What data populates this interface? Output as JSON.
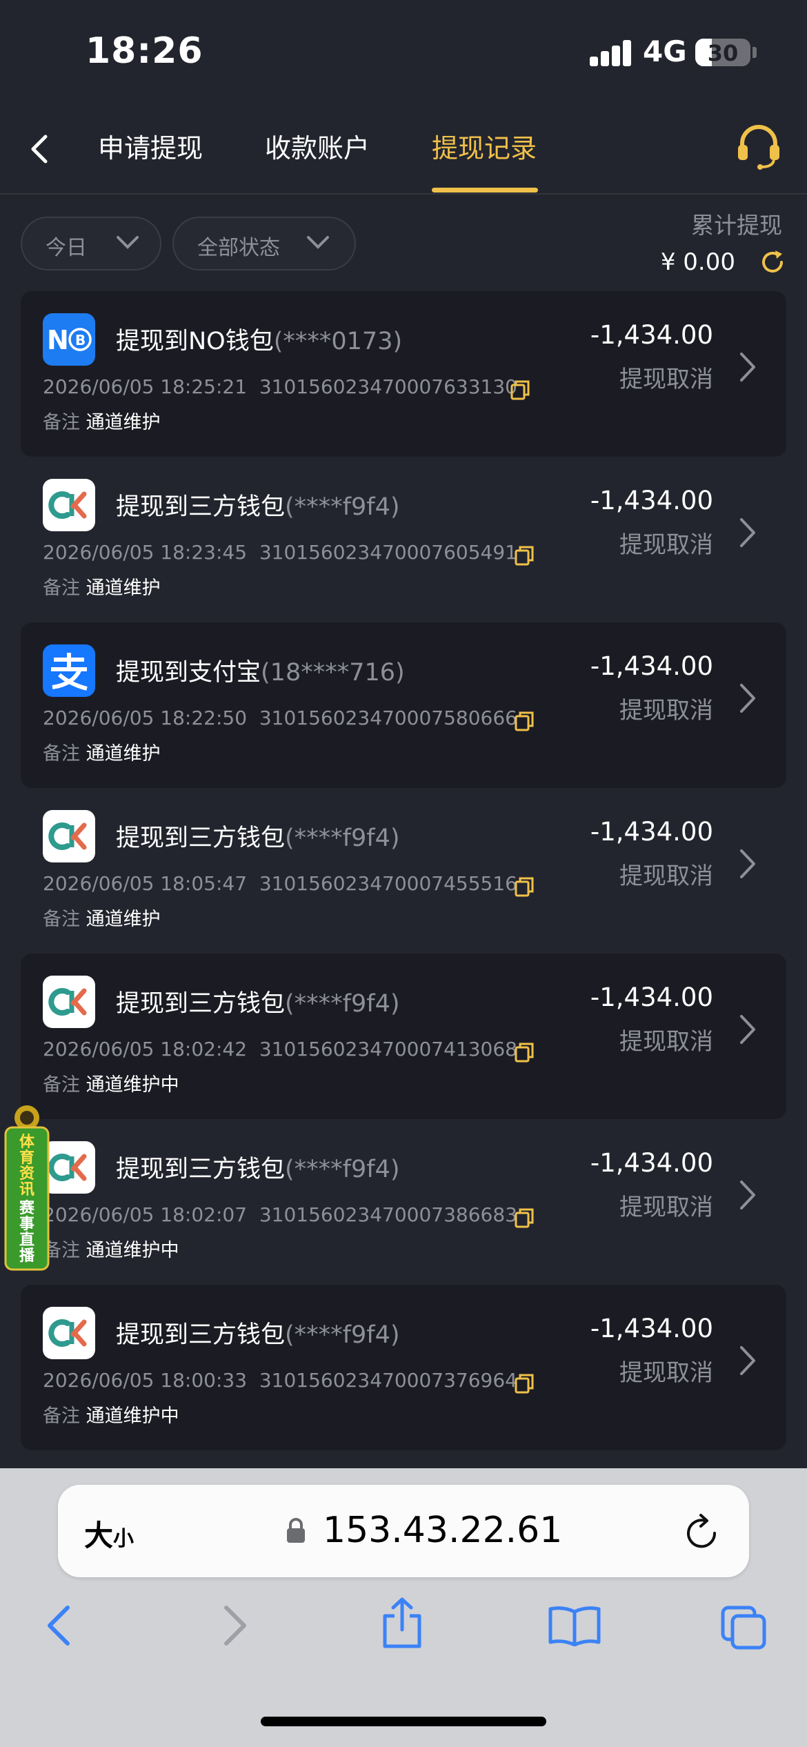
{
  "status_bar": {
    "time": "18:26",
    "network": "4G",
    "battery": "30",
    "battery_level": 0.3
  },
  "nav": {
    "tabs": [
      {
        "label": "申请提现",
        "active": false
      },
      {
        "label": "收款账户",
        "active": false
      },
      {
        "label": "提现记录",
        "active": true
      }
    ]
  },
  "filters": {
    "date": "今日",
    "status": "全部状态"
  },
  "summary": {
    "label": "累计提现",
    "amount": "¥ 0.00"
  },
  "records": [
    {
      "logo": "nb-icon",
      "title": "提现到NO钱包",
      "account": "(****0173)",
      "datetime": "2026/06/05 18:25:21",
      "order_no": "3101560234700076331​30",
      "note_label": "备注",
      "note": "通道维护",
      "amount": "-1,434.00",
      "status": "提现取消"
    },
    {
      "logo": "ck-icon",
      "title": "提现到三方钱包",
      "account": "(****f9f4)",
      "datetime": "2026/06/05 18:23:45",
      "order_no": "310156023470007605491",
      "note_label": "备注",
      "note": "通道维护",
      "amount": "-1,434.00",
      "status": "提现取消"
    },
    {
      "logo": "alipay-icon",
      "title": "提现到支付宝",
      "account": "(18****716)",
      "datetime": "2026/06/05 18:22:50",
      "order_no": "310156023470007580666",
      "note_label": "备注",
      "note": "通道维护",
      "amount": "-1,434.00",
      "status": "提现取消"
    },
    {
      "logo": "ck-icon",
      "title": "提现到三方钱包",
      "account": "(****f9f4)",
      "datetime": "2026/06/05 18:05:47",
      "order_no": "310156023470007455516",
      "note_label": "备注",
      "note": "通道维护",
      "amount": "-1,434.00",
      "status": "提现取消"
    },
    {
      "logo": "ck-icon",
      "title": "提现到三方钱包",
      "account": "(****f9f4)",
      "datetime": "2026/06/05 18:02:42",
      "order_no": "310156023470007413068",
      "note_label": "备注",
      "note": "通道维护中",
      "amount": "-1,434.00",
      "status": "提现取消"
    },
    {
      "logo": "ck-icon",
      "title": "提现到三方钱包",
      "account": "(****f9f4)",
      "datetime": "2026/06/05 18:02:07",
      "order_no": "310156023470007386683",
      "note_label": "备注",
      "note": "通道维护中",
      "amount": "-1,434.00",
      "status": "提现取消"
    },
    {
      "logo": "ck-icon",
      "title": "提现到三方钱包",
      "account": "(****f9f4)",
      "datetime": "2026/06/05 18:00:33",
      "order_no": "310156023470007376964",
      "note_label": "备注",
      "note": "通道维护中",
      "amount": "-1,434.00",
      "status": "提现取消"
    }
  ],
  "float_ad": {
    "line1": "体育资讯",
    "line2": "赛事直播"
  },
  "browser": {
    "text_size": "大",
    "text_size_small": "小",
    "url": "153.43.22.61"
  },
  "colors": {
    "accent": "#f0c14a",
    "background": "#23252e",
    "card": "#1b1c23",
    "muted": "#8e9099",
    "browser_chrome": "#d1d2d6",
    "ios_blue": "#3b82f6"
  }
}
